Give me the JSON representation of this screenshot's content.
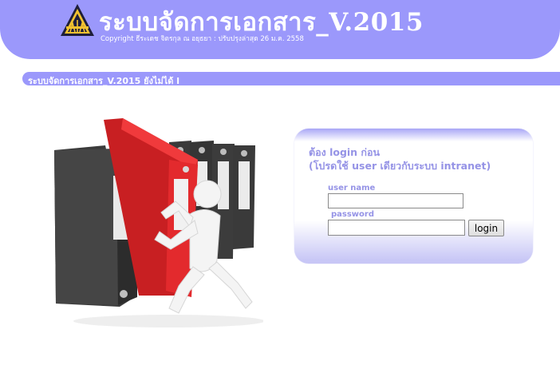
{
  "header": {
    "title": "ระบบจัดการเอกสาร_V.2015",
    "copyright": "Copyright ธีระเดช จิตรกุล ณ อยุธยา : ปรับปรุงล่าสุด 26 ม.ค. 2558",
    "logo_icon": "agency-emblem-icon"
  },
  "notice_bar": {
    "text": "ระบบจัดการเอกสาร_V.2015 ยังไม่ได้ l"
  },
  "illustration": {
    "icon": "binders-figure-illustration"
  },
  "login": {
    "prompt_line1": "ต้อง login ก่อน",
    "prompt_line2": "(โปรดใช้ user เดียวกับระบบ intranet)",
    "username_label": "user name",
    "username_value": "",
    "password_label": "password",
    "password_value": "",
    "button_label": "login"
  },
  "colors": {
    "accent": "#9b98fb",
    "text_accent": "#9593e6",
    "binder_red": "#e8262a",
    "binder_dark": "#3c3c3c"
  }
}
